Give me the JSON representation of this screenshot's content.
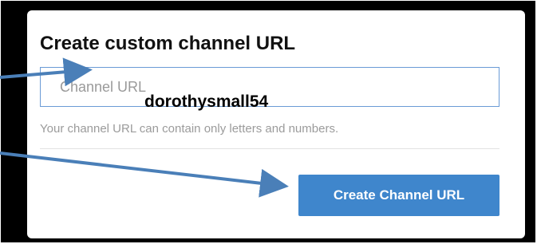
{
  "dialog": {
    "title": "Create custom channel URL",
    "url_input": {
      "placeholder": "Channel URL",
      "typed_value": "dorothysmall54"
    },
    "helper_text": "Your channel URL can contain only letters and numbers.",
    "create_button_label": "Create Channel URL"
  },
  "colors": {
    "frame": "#000000",
    "button": "#3f86cc",
    "input_border": "#6a9bd6",
    "annotation_arrow": "#4a7fb8"
  }
}
